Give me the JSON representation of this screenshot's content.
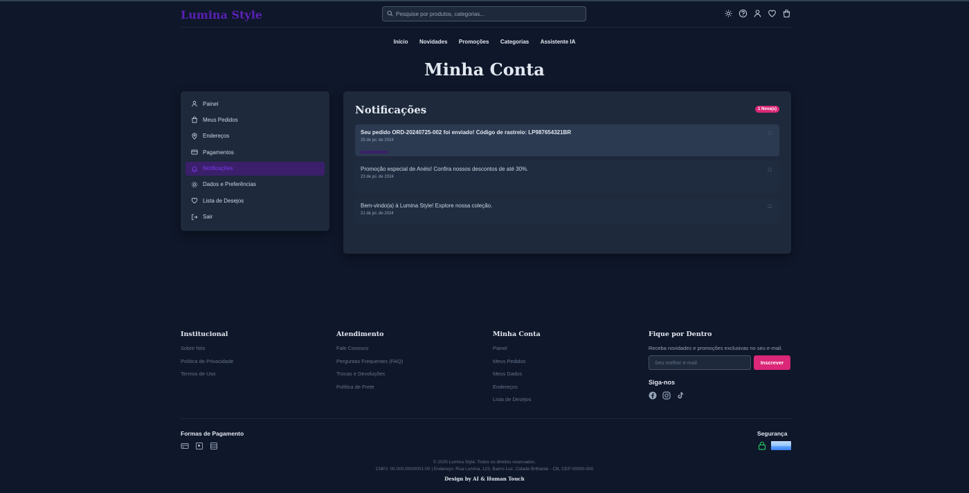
{
  "header": {
    "logo": "Lumina Style",
    "search_placeholder": "Pesquise por produtos, categorias..."
  },
  "nav": {
    "items": [
      "Início",
      "Novidades",
      "Promoções",
      "Categorias",
      "Assistente IA"
    ]
  },
  "page_title": "Minha Conta",
  "sidebar": {
    "items": [
      {
        "label": "Painel",
        "icon": "user-icon"
      },
      {
        "label": "Meus Pedidos",
        "icon": "bag-icon"
      },
      {
        "label": "Endereços",
        "icon": "map-pin-icon"
      },
      {
        "label": "Pagamentos",
        "icon": "credit-card-icon"
      },
      {
        "label": "Notificações",
        "icon": "bell-icon",
        "active": true
      },
      {
        "label": "Dados e Preferências",
        "icon": "gear-icon"
      },
      {
        "label": "Lista de Desejos",
        "icon": "heart-icon"
      },
      {
        "label": "Sair",
        "icon": "logout-icon"
      }
    ]
  },
  "notifications": {
    "title": "Notificações",
    "badge": "1 Nova(s)",
    "items": [
      {
        "message": "Seu pedido ORD-20240725-002 foi enviado! Código de rastreio: LP987654321BR",
        "date": "25 de jul. de 2024",
        "unread": true
      },
      {
        "message": "Promoção especial de Anéis! Confira nossos descontos de até 30%.",
        "date": "23 de jul. de 2024",
        "unread": false
      },
      {
        "message": "Bem-vindo(a) à Lumina Style! Explore nossa coleção.",
        "date": "21 de jul. de 2024",
        "unread": false
      }
    ]
  },
  "footer": {
    "columns": [
      {
        "title": "Institucional",
        "links": [
          "Sobre Nós",
          "Política de Privacidade",
          "Termos de Uso"
        ]
      },
      {
        "title": "Atendimento",
        "links": [
          "Fale Conosco",
          "Perguntas Frequentes (FAQ)",
          "Trocas e Devoluções",
          "Política de Frete"
        ]
      },
      {
        "title": "Minha Conta",
        "links": [
          "Painel",
          "Meus Pedidos",
          "Meus Dados",
          "Endereços",
          "Lista de Desejos"
        ]
      }
    ],
    "newsletter": {
      "title": "Fique por Dentro",
      "text": "Receba novidades e promoções exclusivas no seu e-mail.",
      "placeholder": "Seu melhor e-mail",
      "button": "Inscrever"
    },
    "follow_title": "Siga-nos",
    "socials": [
      "facebook-icon",
      "instagram-icon",
      "tiktok-icon"
    ],
    "payment_title": "Formas de Pagamento",
    "payment_icons": [
      "card-icon",
      "pix-icon",
      "boleto-icon"
    ],
    "security_title": "Segurança",
    "copyright": "© 2025 Lumina Style. Todos os direitos reservados.",
    "company_info": "CNPJ: 00.000.000/0001-00 | Endereço: Rua Lumina, 123, Bairro Luz, Cidade Brilhante - CB, CEP 00000-000",
    "design_credit": "Design by AI & Human Touch"
  },
  "colors": {
    "background": "#0f172a",
    "panel": "#1e293b",
    "brand": "#5b21b6",
    "accent": "#db2777"
  }
}
